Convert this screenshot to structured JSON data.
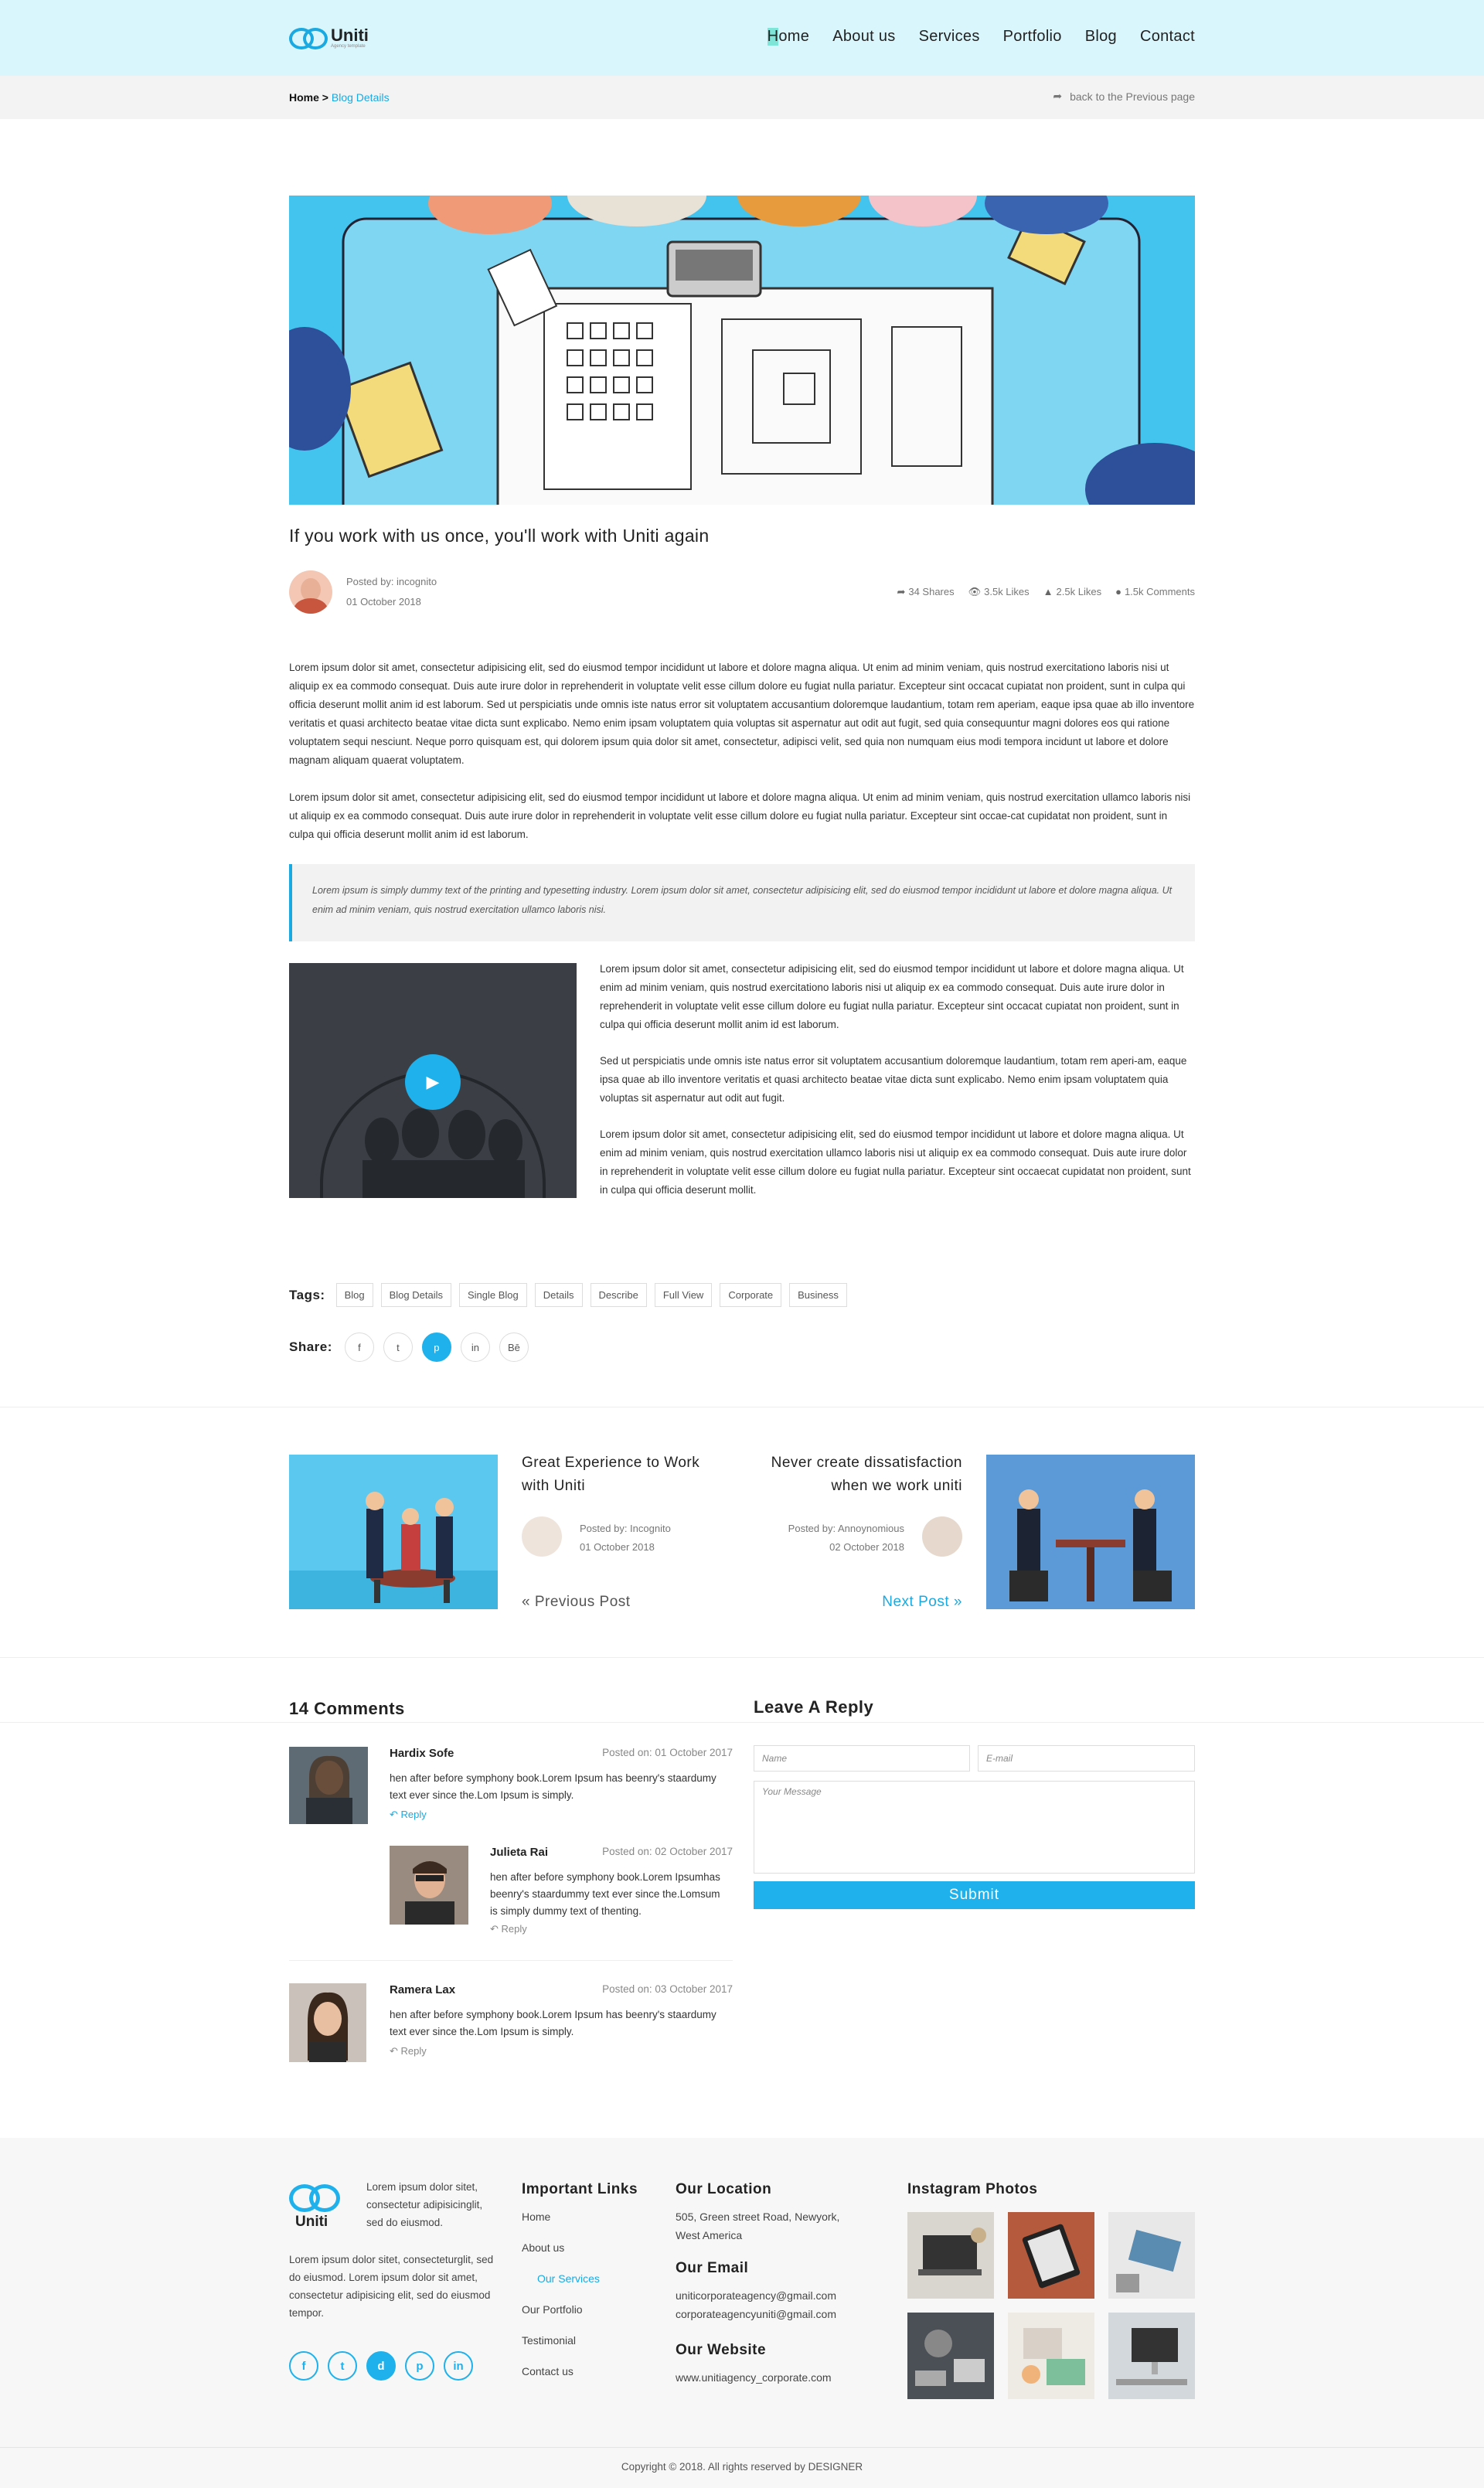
{
  "header": {
    "logo_name": "Uniti",
    "logo_tagline": "Agency template",
    "nav": [
      "Home",
      "About us",
      "Services",
      "Portfolio",
      "Blog",
      "Contact"
    ]
  },
  "breadcrumb": {
    "home": "Home",
    "separator": ">",
    "current": "Blog Details",
    "back": "back to the Previous page"
  },
  "post": {
    "title": "If you work with us once, you'll work with Uniti again",
    "author": "Posted by: incognito",
    "date": "01 October 2018",
    "shares": "34 Shares",
    "views": "3.5k Likes",
    "likes": "2.5k Likes",
    "comments": "1.5k Comments",
    "para1": "Lorem ipsum dolor sit amet, consectetur adipisicing elit, sed do eiusmod tempor incididunt ut labore et dolore magna aliqua. Ut enim ad minim veniam, quis nostrud exercitationo laboris nisi ut aliquip ex ea commodo consequat. Duis aute irure dolor in reprehenderit in voluptate velit esse cillum dolore eu fugiat nulla pariatur. Excepteur sint occacat cupiatat non proident, sunt in culpa qui officia deserunt mollit anim id est laborum. Sed ut perspiciatis unde omnis iste natus error sit voluptatem accusantium doloremque laudantium, totam rem aperiam, eaque ipsa quae ab illo inventore veritatis et quasi architecto beatae vitae dicta sunt explicabo. Nemo enim ipsam voluptatem quia voluptas sit aspernatur aut odit aut fugit, sed quia consequuntur magni dolores eos qui ratione voluptatem sequi nesciunt. Neque porro quisquam est, qui dolorem ipsum quia dolor sit amet, consectetur, adipisci velit, sed quia non numquam eius modi tempora incidunt ut labore et dolore magnam aliquam quaerat voluptatem.",
    "para2": "Lorem ipsum dolor sit amet, consectetur adipisicing elit, sed do eiusmod tempor incididunt ut labore et dolore magna aliqua. Ut enim ad minim veniam, quis nostrud exercitation ullamco laboris nisi ut aliquip ex ea commodo consequat. Duis aute irure dolor in reprehenderit in voluptate velit esse cillum dolore eu fugiat nulla pariatur. Excepteur sint occae-cat cupidatat non proident, sunt in culpa qui officia deserunt mollit anim id est laborum.",
    "quote": "Lorem ipsum is simply dummy text of the printing and typesetting industry. Lorem ipsum dolor sit amet, consectetur adipisicing elit, sed do eiusmod tempor incididunt ut labore et dolore magna aliqua. Ut enim ad minim veniam, quis nostrud exercitation ullamco laboris nisi.",
    "video_p1": "Lorem ipsum dolor sit amet, consectetur adipisicing elit, sed do eiusmod tempor incididunt ut labore et dolore magna aliqua. Ut enim ad minim veniam, quis nostrud exercitationo laboris nisi ut aliquip ex ea commodo consequat. Duis aute irure dolor in reprehenderit in voluptate velit esse cillum dolore eu fugiat nulla pariatur. Excepteur sint occacat cupiatat non proident, sunt in culpa qui officia deserunt mollit anim id est laborum.",
    "video_p2": "Sed ut perspiciatis unde omnis iste natus error sit voluptatem accusantium doloremque laudantium, totam rem aperi-am, eaque ipsa quae ab illo inventore veritatis et quasi architecto beatae vitae dicta sunt explicabo. Nemo enim ipsam voluptatem quia voluptas sit aspernatur aut odit aut fugit.",
    "video_p3": "Lorem ipsum dolor sit amet, consectetur adipisicing elit, sed do eiusmod tempor incididunt ut labore et dolore magna aliqua. Ut enim ad minim veniam, quis nostrud exercitation ullamco laboris nisi ut aliquip ex ea commodo consequat. Duis aute irure dolor in reprehenderit in voluptate velit esse cillum dolore eu fugiat nulla pariatur. Excepteur sint occaecat cupidatat non proident, sunt in culpa qui officia deserunt mollit."
  },
  "tags": {
    "label": "Tags:",
    "items": [
      "Blog",
      "Blog Details",
      "Single Blog",
      "Details",
      "Describe",
      "Full View",
      "Corporate",
      "Business"
    ]
  },
  "share": {
    "label": "Share:",
    "icons": [
      "f",
      "t",
      "p",
      "in",
      "Bē"
    ]
  },
  "prev_post": {
    "title_line1": "Great Experience to Work",
    "title_line2": "with Uniti",
    "author": "Posted by: Incognito",
    "date": "01 October 2018",
    "link": "Previous Post"
  },
  "next_post": {
    "title_line1": "Never create dissatisfaction",
    "title_line2": "when we work uniti",
    "author": "Posted by: Annoynomious",
    "date": "02 October 2018",
    "link": "Next Post"
  },
  "comments": {
    "heading": "14 Comments",
    "items": [
      {
        "name": "Hardix Sofe",
        "date": "Posted on: 01 October 2017",
        "text": "hen after before symphony book.Lorem Ipsum has beenry's staardumy text ever since the.Lom Ipsum is simply.",
        "reply": "Reply"
      },
      {
        "name": "Julieta Rai",
        "date": "Posted on: 02 October 2017",
        "text": "hen after before symphony book.Lorem Ipsumhas beenry's staardummy text ever since the.Lomsum is simply dummy text of thenting.",
        "reply": "Reply"
      },
      {
        "name": "Ramera Lax",
        "date": "Posted on: 03 October 2017",
        "text": "hen after before symphony book.Lorem Ipsum has beenry's staardumy text ever since the.Lom Ipsum is simply.",
        "reply": "Reply"
      }
    ]
  },
  "reply_form": {
    "heading": "Leave A Reply",
    "name_placeholder": "Name",
    "email_placeholder": "E-mail",
    "message_placeholder": "Your Message",
    "submit": "Submit"
  },
  "footer": {
    "logo_name": "Uniti",
    "about1": "Lorem ipsum dolor sitet, consectetur adipisicinglit, sed do eiusmod.",
    "about2": "Lorem ipsum dolor sitet, consecteturglit, sed do eiusmod. Lorem ipsum dolor sit amet, consectetur adipisicing elit, sed do eiusmod tempor.",
    "social": [
      "f",
      "t",
      "d",
      "p",
      "in"
    ],
    "links_heading": "Important Links",
    "links": [
      "Home",
      "About us",
      "Our Services",
      "Our Portfolio",
      "Testimonial",
      "Contact us"
    ],
    "location_heading": "Our Location",
    "location": "505, Green street Road, Newyork, West America",
    "email_heading": "Our Email",
    "email1": "uniticorporateagency@gmail.com",
    "email2": "corporateagencyuniti@gmail.com",
    "website_heading": "Our Website",
    "website": "www.unitiagency_corporate.com",
    "instagram_heading": "Instagram Photos",
    "copyright": "Copyright © 2018. All rights reserved by DESIGNER"
  },
  "colors": {
    "accent": "#1eb1ec",
    "header_bg": "#d9f6fd"
  }
}
